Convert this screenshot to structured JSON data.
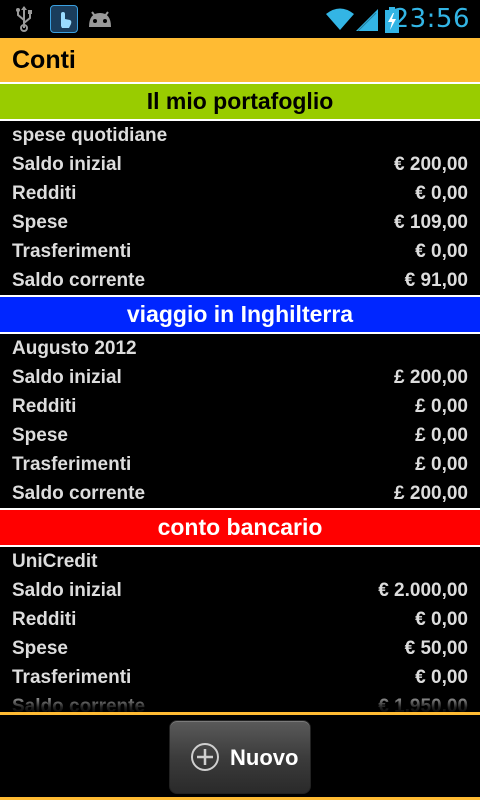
{
  "status_bar": {
    "time": "23:56",
    "icons": [
      "usb-icon",
      "touch-icon",
      "android-icon",
      "wifi-icon",
      "signal-icon",
      "battery-charging-icon"
    ]
  },
  "app": {
    "title": "Conti"
  },
  "accounts": [
    {
      "name": "Il mio portafoglio",
      "header_color": "#99cc00",
      "header_text_color": "#000000",
      "description": "spese quotidiane",
      "rows": [
        {
          "label": "Saldo inizial",
          "value": "€ 200,00"
        },
        {
          "label": "Redditi",
          "value": "€ 0,00"
        },
        {
          "label": "Spese",
          "value": "€ 109,00"
        },
        {
          "label": "Trasferimenti",
          "value": "€ 0,00"
        },
        {
          "label": "Saldo corrente",
          "value": "€ 91,00"
        }
      ]
    },
    {
      "name": "viaggio in Inghilterra",
      "header_color": "#0026ff",
      "header_text_color": "#ffffff",
      "description": "Augusto 2012",
      "rows": [
        {
          "label": "Saldo inizial",
          "value": "£ 200,00"
        },
        {
          "label": "Redditi",
          "value": "£ 0,00"
        },
        {
          "label": "Spese",
          "value": "£ 0,00"
        },
        {
          "label": "Trasferimenti",
          "value": "£ 0,00"
        },
        {
          "label": "Saldo corrente",
          "value": "£ 200,00"
        }
      ]
    },
    {
      "name": "conto bancario",
      "header_color": "#ff0000",
      "header_text_color": "#ffffff",
      "description": "UniCredit",
      "rows": [
        {
          "label": "Saldo inizial",
          "value": "€ 2.000,00"
        },
        {
          "label": "Redditi",
          "value": "€ 0,00"
        },
        {
          "label": "Spese",
          "value": "€ 50,00"
        },
        {
          "label": "Trasferimenti",
          "value": "€ 0,00"
        },
        {
          "label": "Saldo corrente",
          "value": "€ 1.950,00"
        }
      ]
    }
  ],
  "bottom_bar": {
    "new_button_label": "Nuovo",
    "new_button_icon": "add-circle-icon",
    "accent_color": "#ffbb33"
  }
}
